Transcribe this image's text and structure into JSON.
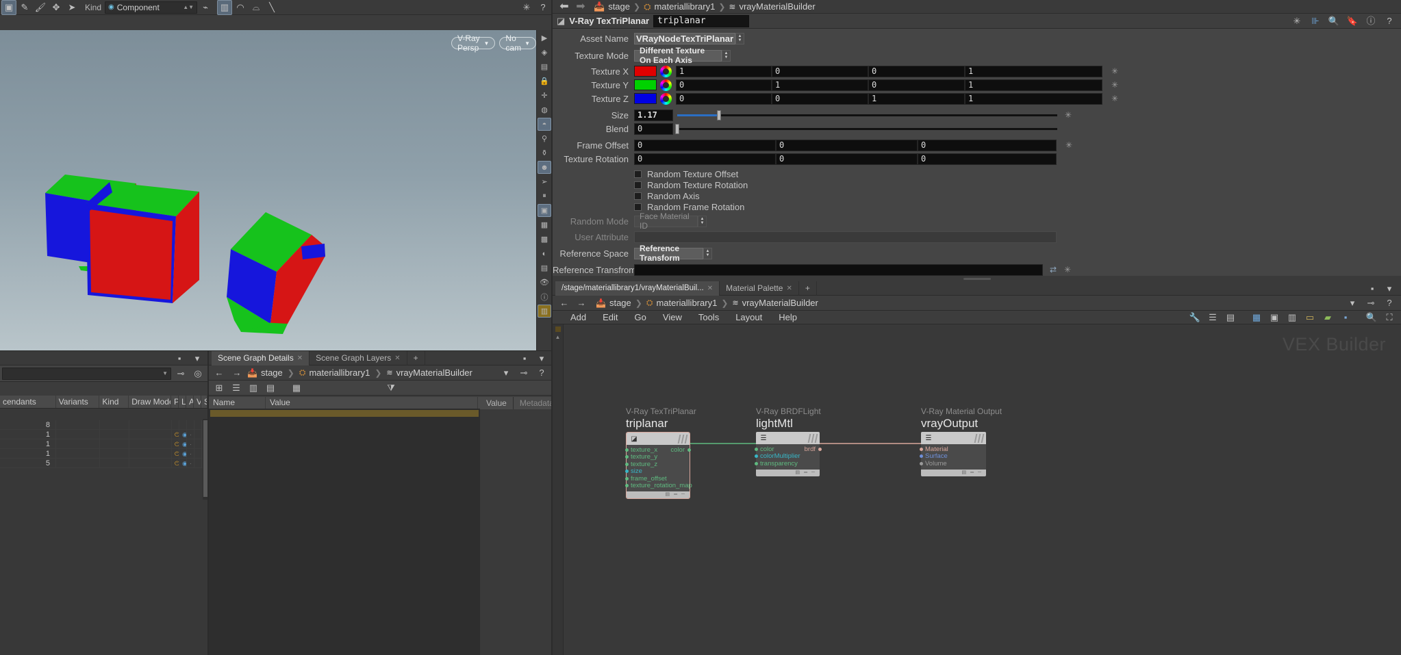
{
  "viewport": {
    "toolbar_left_icons": [
      "select-tool",
      "brush-tool",
      "paint-tool",
      "handle-tool",
      "pick-tool"
    ],
    "kind_label": "Kind",
    "kind_value": "Component",
    "camera_pill": "V-Ray Persp",
    "cam_pill": "No cam",
    "right_rail_icons": [
      "display-options",
      "material-icon",
      "render-icon",
      "lock-icon",
      "snap-icon",
      "sphere-icon",
      "light-icon",
      "point-light-icon",
      "spot-light-icon",
      "env-light-icon",
      "head-icon",
      "cursor-icon",
      "pause-icon",
      "camera-icon",
      "grid-icon",
      "eye-icon",
      "info-icon",
      "layout-icon"
    ]
  },
  "breadcrumb_top": {
    "back": "back-arrow",
    "forward": "forward-arrow",
    "items": [
      {
        "label": "stage",
        "icon": "stage-icon"
      },
      {
        "label": "materiallibrary1",
        "icon": "materiallibrary-icon"
      },
      {
        "label": "vrayMaterialBuilder",
        "icon": "builder-icon"
      }
    ]
  },
  "node_header": {
    "type": "V-Ray TexTriPlanar",
    "name": "triplanar",
    "icons": [
      "gear-icon",
      "histogram-icon",
      "search-icon",
      "bookmark-icon",
      "info-icon",
      "help-icon"
    ]
  },
  "params": {
    "asset_name": {
      "label": "Asset Name",
      "value": "VRayNodeTexTriPlanar"
    },
    "texture_mode": {
      "label": "Texture Mode",
      "value": "Different Texture On Each Axis"
    },
    "texture_x": {
      "label": "Texture X",
      "color": "#e00000",
      "values": [
        "1",
        "0",
        "0",
        "1"
      ]
    },
    "texture_y": {
      "label": "Texture Y",
      "color": "#00d200",
      "values": [
        "0",
        "1",
        "0",
        "1"
      ]
    },
    "texture_z": {
      "label": "Texture Z",
      "color": "#0000e4",
      "values": [
        "0",
        "0",
        "1",
        "1"
      ]
    },
    "size": {
      "label": "Size",
      "value": "1.17",
      "slider_pct": 11
    },
    "blend": {
      "label": "Blend",
      "value": "0",
      "slider_pct": 0
    },
    "frame_offset": {
      "label": "Frame Offset",
      "values": [
        "0",
        "0",
        "0"
      ]
    },
    "texture_rotation": {
      "label": "Texture Rotation",
      "values": [
        "0",
        "0",
        "0"
      ]
    },
    "checkboxes": [
      {
        "label": "Random Texture Offset",
        "checked": false
      },
      {
        "label": "Random Texture Rotation",
        "checked": false
      },
      {
        "label": "Random Axis",
        "checked": false
      },
      {
        "label": "Random Frame Rotation",
        "checked": false
      }
    ],
    "random_mode": {
      "label": "Random Mode",
      "value": "Face Material ID",
      "disabled": true
    },
    "user_attribute": {
      "label": "User Attribute",
      "value": "",
      "disabled": true
    },
    "reference_space": {
      "label": "Reference Space",
      "value": "Reference Transform"
    },
    "reference_transform": {
      "label": "Reference Transfrom...",
      "value": ""
    }
  },
  "lower_left": {
    "columns": [
      "cendants",
      "Variants",
      "Kind",
      "Draw Mode",
      "P",
      "L",
      "A",
      "V",
      "S"
    ],
    "rows": [
      {
        "cendants": "8",
        "variants": "",
        "kind": "",
        "draw": "",
        "flags": ""
      },
      {
        "cendants": "1",
        "variants": "",
        "kind": "",
        "draw": "",
        "flags": "on"
      },
      {
        "cendants": "1",
        "variants": "",
        "kind": "",
        "draw": "",
        "flags": "on"
      },
      {
        "cendants": "1",
        "variants": "",
        "kind": "",
        "draw": "",
        "flags": "on"
      },
      {
        "cendants": "5",
        "variants": "",
        "kind": "",
        "draw": "",
        "flags": "on"
      }
    ]
  },
  "scene_graph_details": {
    "tabs": [
      {
        "label": "Scene Graph Details",
        "active": true,
        "closable": true
      },
      {
        "label": "Scene Graph Layers",
        "active": false,
        "closable": true
      }
    ],
    "add_tab": "+",
    "breadcrumb": [
      {
        "label": "stage",
        "icon": "stage-icon"
      },
      {
        "label": "materiallibrary1",
        "icon": "materiallibrary-icon"
      },
      {
        "label": "vrayMaterialBuilder",
        "icon": "builder-icon"
      }
    ],
    "columns": [
      "Name",
      "Value"
    ],
    "right_tabs": [
      "Value",
      "Metadata"
    ],
    "rows": []
  },
  "network_editor": {
    "tabs": [
      {
        "label": "/stage/materiallibrary1/vrayMaterialBuil...",
        "active": true,
        "closable": true
      },
      {
        "label": "Material Palette",
        "active": false,
        "closable": true
      }
    ],
    "add_tab": "+",
    "breadcrumb": [
      {
        "label": "stage",
        "icon": "stage-icon"
      },
      {
        "label": "materiallibrary1",
        "icon": "materiallibrary-icon"
      },
      {
        "label": "vrayMaterialBuilder",
        "icon": "builder-icon"
      }
    ],
    "menu": [
      "Add",
      "Edit",
      "Go",
      "View",
      "Tools",
      "Layout",
      "Help"
    ],
    "watermark": "VEX Builder",
    "nodes": [
      {
        "type": "V-Ray TexTriPlanar",
        "name": "triplanar",
        "selected": true,
        "icon": "triplanar-icon",
        "inputs": [
          "texture_x",
          "texture_y",
          "texture_z",
          "size",
          "frame_offset",
          "texture_rotation_map"
        ],
        "outputs": [
          "color"
        ]
      },
      {
        "type": "V-Ray BRDFLight",
        "name": "lightMtl",
        "selected": false,
        "icon": "brdf-icon",
        "inputs": [
          "color",
          "colorMultiplier",
          "transparency"
        ],
        "outputs": [
          "brdf"
        ]
      },
      {
        "type": "V-Ray Material Output",
        "name": "vrayOutput",
        "selected": false,
        "icon": "output-icon",
        "inputs": [
          "Material",
          "Surface",
          "Volume"
        ],
        "outputs": []
      }
    ]
  },
  "colors": {
    "accent_blue": "#2a6ec4",
    "port_green": "#5fba80",
    "port_cyan": "#37b6c6",
    "port_peach": "#d9a79c",
    "port_blue": "#6f8fd8",
    "port_grey": "#9a9a9a",
    "selection_gold": "#6a5a2a"
  }
}
